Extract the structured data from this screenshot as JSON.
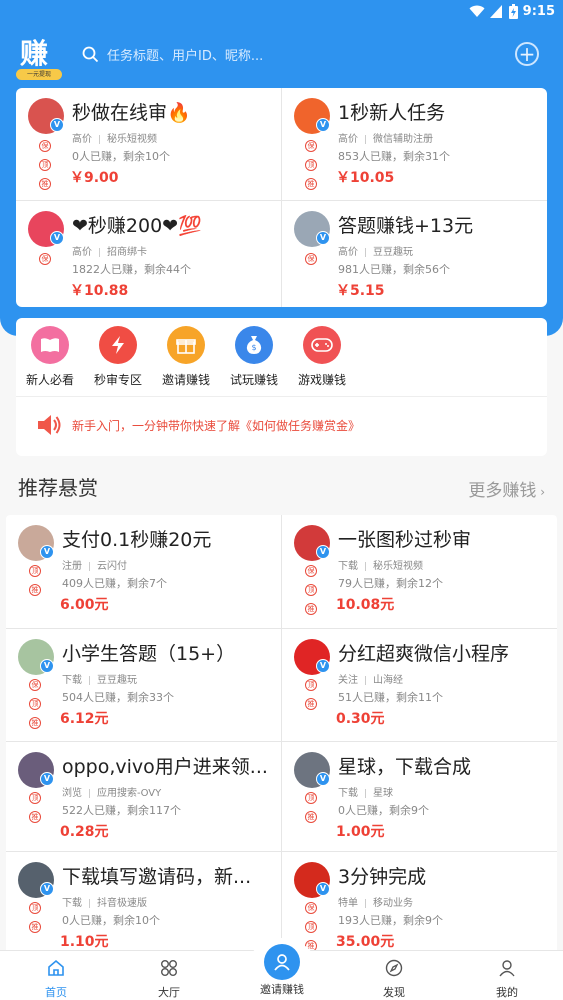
{
  "status": {
    "time": "9:15"
  },
  "header": {
    "logo_text": "赚",
    "logo_tag": "一元提现",
    "search_placeholder": "任务标题、用户ID、昵称..."
  },
  "top_tasks": [
    {
      "title": "秒做在线审🔥",
      "tag": "高价",
      "app": "秘乐短视频",
      "count": "0人已赚，剩余10个",
      "price": "￥9.00",
      "seals": [
        "保",
        "顶",
        "推"
      ]
    },
    {
      "title": "1秒新人任务",
      "tag": "高价",
      "app": "微信辅助注册",
      "count": "853人已赚，剩余31个",
      "price": "￥10.05",
      "seals": [
        "保",
        "顶",
        "推"
      ]
    },
    {
      "title": "❤秒赚200❤💯",
      "tag": "高价",
      "app": "招商绑卡",
      "count": "1822人已赚，剩余44个",
      "price": "￥10.88",
      "seals": [
        "保"
      ]
    },
    {
      "title": "答题赚钱+13元",
      "tag": "高价",
      "app": "豆豆趣玩",
      "count": "981人已赚，剩余56个",
      "price": "￥5.15",
      "seals": [
        "保"
      ]
    }
  ],
  "categories": [
    {
      "label": "新人必看",
      "color": "#f36fa0"
    },
    {
      "label": "秒审专区",
      "color": "#f04d44"
    },
    {
      "label": "邀请赚钱",
      "color": "#f7a428"
    },
    {
      "label": "试玩赚钱",
      "color": "#3a87ea"
    },
    {
      "label": "游戏赚钱",
      "color": "#f05254"
    }
  ],
  "notice": "新手入门，一分钟带你快速了解《如何做任务赚赏金》",
  "section": {
    "title": "推荐悬赏",
    "more": "更多赚钱"
  },
  "list_tasks": [
    {
      "title": "支付0.1秒赚20元",
      "tag": "注册",
      "app": "云闪付",
      "count": "409人已赚，剩余7个",
      "price": "6.00元",
      "seals": [
        "顶",
        "推"
      ]
    },
    {
      "title": "一张图秒过秒审",
      "tag": "下载",
      "app": "秘乐短视频",
      "count": "79人已赚，剩余12个",
      "price": "10.08元",
      "seals": [
        "保",
        "顶",
        "推"
      ]
    },
    {
      "title": "小学生答题（15+）",
      "tag": "下载",
      "app": "豆豆趣玩",
      "count": "504人已赚，剩余33个",
      "price": "6.12元",
      "seals": [
        "保",
        "顶",
        "推"
      ]
    },
    {
      "title": "分红超爽微信小程序",
      "tag": "关注",
      "app": "山海经",
      "count": "51人已赚，剩余11个",
      "price": "0.30元",
      "seals": [
        "顶",
        "推"
      ]
    },
    {
      "title": "oppo,vivo用户进来领...",
      "tag": "浏览",
      "app": "应用搜索-OVY",
      "count": "522人已赚，剩余117个",
      "price": "0.28元",
      "seals": [
        "顶",
        "推"
      ]
    },
    {
      "title": "星球，下载合成",
      "tag": "下载",
      "app": "星球",
      "count": "0人已赚，剩余9个",
      "price": "1.00元",
      "seals": [
        "顶",
        "推"
      ]
    },
    {
      "title": "下载填写邀请码，新...",
      "tag": "下载",
      "app": "抖音极速版",
      "count": "0人已赚，剩余10个",
      "price": "1.10元",
      "seals": [
        "顶",
        "推"
      ]
    },
    {
      "title": "3分钟完成",
      "tag": "特单",
      "app": "移动业务",
      "count": "193人已赚，剩余9个",
      "price": "35.00元",
      "seals": [
        "保",
        "顶",
        "推"
      ]
    }
  ],
  "tabs": [
    {
      "label": "首页",
      "icon": "home-icon"
    },
    {
      "label": "大厅",
      "icon": "grid-icon"
    },
    {
      "label": "邀请赚钱",
      "icon": "user-icon"
    },
    {
      "label": "发现",
      "icon": "compass-icon"
    },
    {
      "label": "我的",
      "icon": "profile-icon"
    }
  ],
  "colors": {
    "brand": "#2e93ef",
    "price": "#ee4136"
  }
}
